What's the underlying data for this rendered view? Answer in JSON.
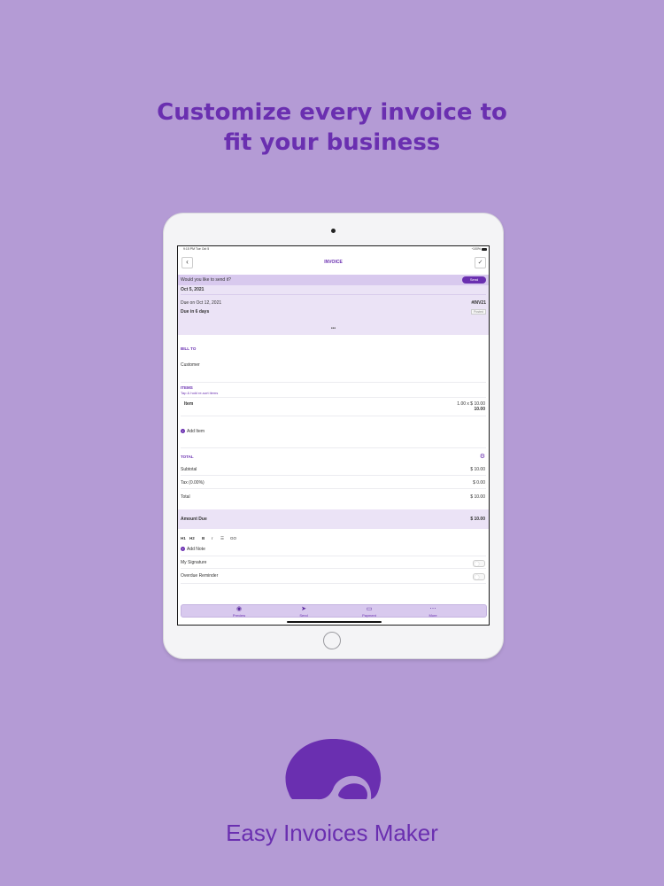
{
  "headline": {
    "line1": "Customize every invoice to",
    "line2": "fit your business"
  },
  "status_bar": {
    "time": "9:15 PM   Tue Oct 5",
    "battery": "100%"
  },
  "nav": {
    "title": "INVOICE",
    "back_icon": "chevron-left-icon",
    "done_icon": "check-icon"
  },
  "send_banner": {
    "question": "Would you like to send it?",
    "button": "Send"
  },
  "invoice_header": {
    "date": "Oct 5, 2021",
    "due_on": "Due on Oct 12, 2021",
    "number": "#INV21",
    "due_in": "Due in 6 days",
    "status": "Posted",
    "more": "•••"
  },
  "bill_to": {
    "heading": "BILL TO",
    "customer": "Customer"
  },
  "items": {
    "heading": "ITEMS",
    "hint": "Tap & hold re-sort items",
    "item_name": "Item",
    "item_qty_price": "1.00 x $ 10.00",
    "item_total": "10.00",
    "add_label": "Add Item"
  },
  "totals": {
    "heading": "TOTAL",
    "subtotal_label": "Subtotal",
    "subtotal_value": "$ 10.00",
    "tax_label": "Tax (0.00%)",
    "tax_value": "$ 0.00",
    "total_label": "Total",
    "total_value": "$ 10.00",
    "amount_due_label": "Amount Due",
    "amount_due_value": "$ 10.00"
  },
  "formatting": {
    "h1": "H1",
    "h2": "H2",
    "bold": "B",
    "italic": "I",
    "list": "☰",
    "link": "GO"
  },
  "notes": {
    "add_note": "Add Note",
    "signature": "My Signature",
    "reminder": "Overdue Reminder"
  },
  "tabs": [
    {
      "label": "Preview",
      "icon": "eye-icon"
    },
    {
      "label": "Send",
      "icon": "send-icon"
    },
    {
      "label": "Payment",
      "icon": "card-icon"
    },
    {
      "label": "More",
      "icon": "more-icon"
    }
  ],
  "brand": {
    "name": "Easy Invoices Maker"
  },
  "colors": {
    "background": "#b49bd5",
    "accent": "#6a2fb0",
    "panel": "#ebe3f6"
  }
}
